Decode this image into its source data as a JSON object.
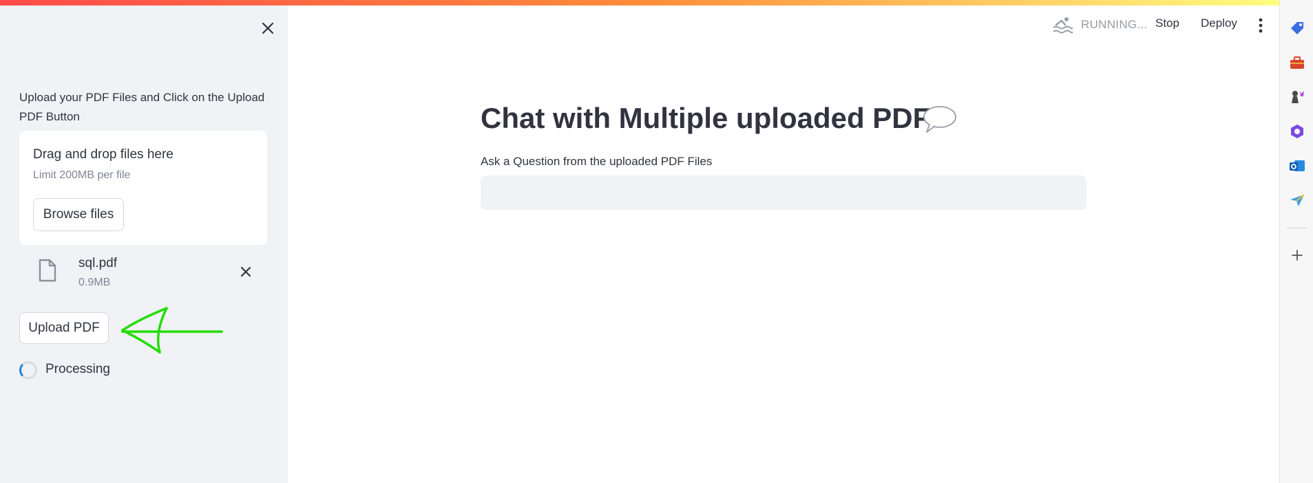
{
  "header": {
    "status_text": "RUNNING...",
    "stop_label": "Stop",
    "deploy_label": "Deploy"
  },
  "sidebar": {
    "instruction": "Upload your PDF Files and Click on the Upload PDF Button",
    "dropzone": {
      "title": "Drag and drop files here",
      "limit": "Limit 200MB per file",
      "browse_label": "Browse files"
    },
    "file": {
      "name": "sql.pdf",
      "size": "0.9MB"
    },
    "upload_label": "Upload PDF",
    "processing_text": "Processing"
  },
  "main": {
    "title": "Chat with Multiple uploaded PDF",
    "question_label": "Ask a Question from the uploaded PDF Files",
    "question_value": ""
  },
  "colors": {
    "accent": "#ff4b4b",
    "sidebar_bg": "#f0f2f6",
    "annotation": "#22dd00"
  },
  "icons": {
    "sidebar_close": "close-icon",
    "file": "file-icon",
    "file_remove": "close-icon",
    "running": "swimmer-icon",
    "menu": "kebab-menu-icon",
    "title_emoji": "speech-bubble-icon",
    "strip": [
      "tag-icon",
      "toolbox-icon",
      "chess-icon",
      "copilot-icon",
      "outlook-icon",
      "send-icon",
      "plus-icon"
    ]
  }
}
